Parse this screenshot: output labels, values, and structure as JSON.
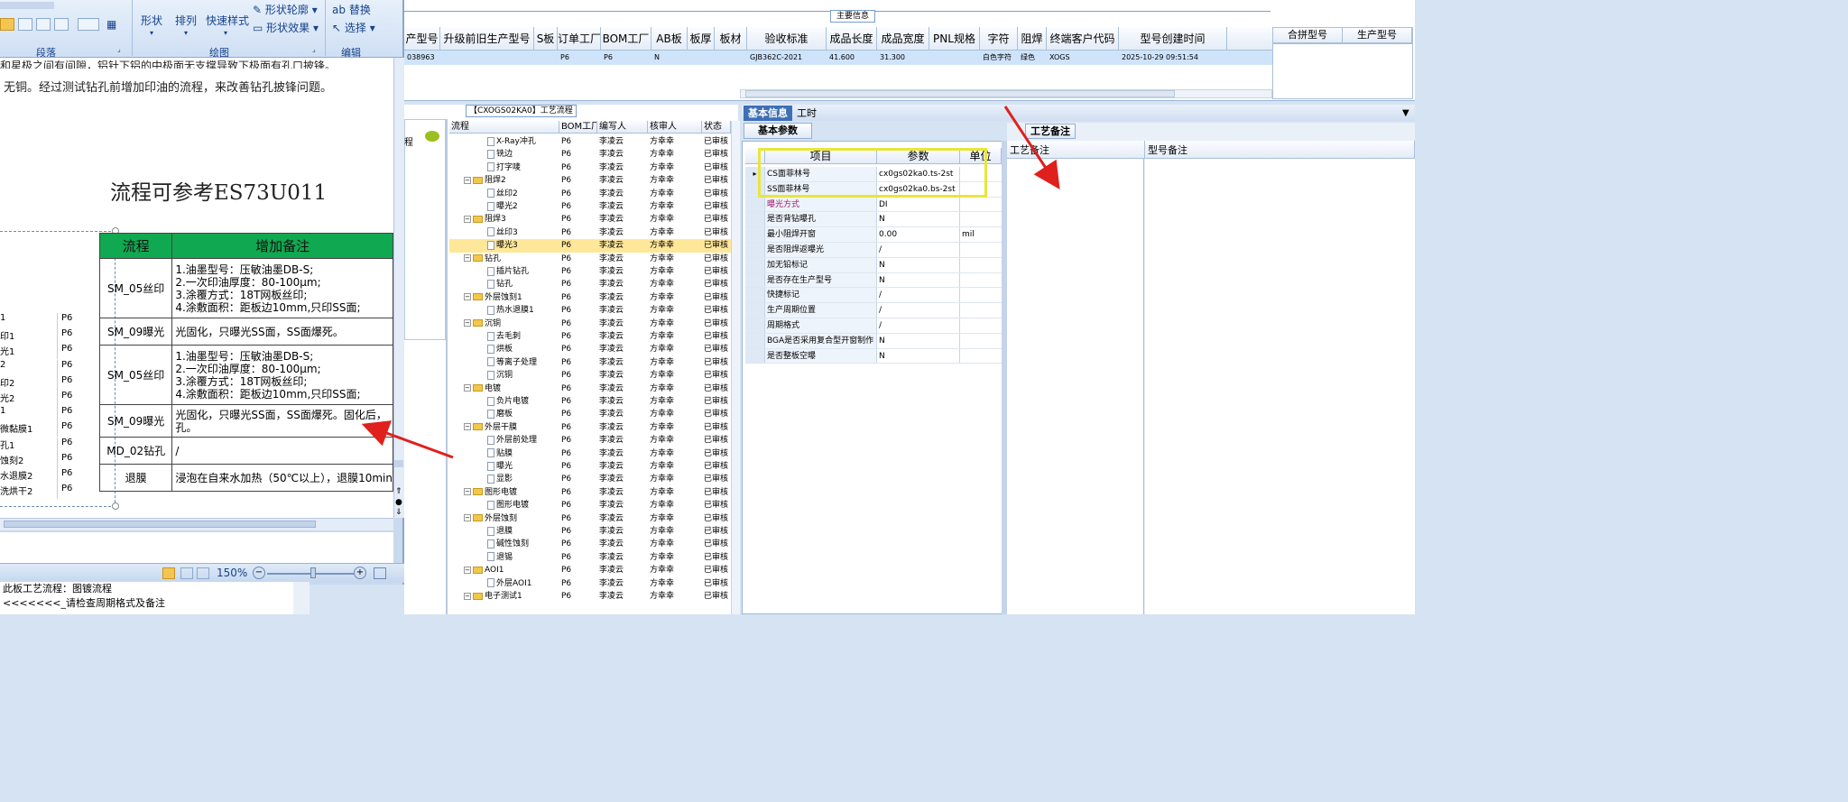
{
  "ribbon": {
    "group_paragraph": "段落",
    "group_drawing": "绘图",
    "group_edit": "编辑",
    "shape_label": "形状",
    "arrange_label": "排列",
    "quick_style_label": "快速样式",
    "shape_outline": "形状轮廓",
    "shape_effect": "形状效果",
    "replace": "替换",
    "select": "选择"
  },
  "document": {
    "line1": "和星极之间有间隙，铝针下铝的中极面无支撑导致下极面有孔口披锋。",
    "line2": "无铜。经过测试钻孔前增加印油的流程，来改善钻孔披锋问题。",
    "title": "流程可参考ES73U011",
    "table_headers": [
      "流程",
      "增加备注"
    ],
    "table_rows": [
      {
        "step": "SM_05丝印",
        "note": [
          "1.油墨型号：压敏油墨DB-S;",
          "2.一次印油厚度：80-100μm;",
          "3.涂覆方式：18T网板丝印;",
          "4.涂敷面积：距板边10mm,只印SS面;"
        ]
      },
      {
        "step": "SM_09曝光",
        "note": [
          "光固化，只曝光SS面，SS面爆死。"
        ]
      },
      {
        "step": "SM_05丝印",
        "note": [
          "1.油墨型号：压敏油墨DB-S;",
          "2.一次印油厚度：80-100μm;",
          "3.涂覆方式：18T网板丝印;",
          "4.涂敷面积：距板边10mm,只印SS面;"
        ]
      },
      {
        "step": "SM_09曝光",
        "note": [
          "光固化，只曝光SS面，SS面爆死。固化后，",
          "孔。"
        ]
      },
      {
        "step": "MD_02钻孔",
        "note": [
          "/"
        ]
      },
      {
        "step": "退膜",
        "note": [
          "浸泡在自来水加热（50℃以上），退膜10min"
        ]
      }
    ],
    "left_list": [
      {
        "name": "1",
        "bom": "P6"
      },
      {
        "name": "印1",
        "bom": "P6"
      },
      {
        "name": "光1",
        "bom": "P6"
      },
      {
        "name": "2",
        "bom": "P6"
      },
      {
        "name": "印2",
        "bom": "P6"
      },
      {
        "name": "光2",
        "bom": "P6"
      },
      {
        "name": "1",
        "bom": "P6"
      },
      {
        "name": "微黏膜1",
        "bom": "P6"
      },
      {
        "name": "孔1",
        "bom": "P6"
      },
      {
        "name": "蚀刻2",
        "bom": "P6"
      },
      {
        "name": "水退膜2",
        "bom": "P6"
      },
      {
        "name": "洗烘干2",
        "bom": "P6"
      }
    ],
    "zoom": "150%",
    "note1": "此板工艺流程：图镀流程",
    "note2": "<<<<<<<_请检查周期格式及备注"
  },
  "top_grid": {
    "section_label": "主要信息",
    "headers": [
      "产型号",
      "升级前旧生产型号",
      "S板",
      "订单工厂",
      "BOM工厂",
      "AB板",
      "板厚",
      "板材",
      "验收标准",
      "成品长度",
      "成品宽度",
      "PNL规格",
      "字符",
      "阻焊",
      "终端客户代码",
      "型号创建时间"
    ],
    "row": [
      "038963",
      "",
      "",
      "P6",
      "P6",
      "N",
      "",
      "",
      "GJB362C-2021",
      "41.600",
      "31.300",
      "",
      "白色字符",
      "绿色",
      "XOGS",
      "2025-10-29 09:51:54"
    ],
    "right_headers": [
      "合拼型号",
      "生产型号"
    ]
  },
  "process": {
    "title": "【CXOGS02KA0】工艺流程",
    "headers": [
      "流程",
      "BOM工厂",
      "编写人",
      "核审人",
      "状态"
    ],
    "rows": [
      {
        "indent": 2,
        "kind": "doc",
        "name": "X-Ray冲孔",
        "bom": "P6",
        "w": "李凌云",
        "r": "方幸幸",
        "s": "已审核"
      },
      {
        "indent": 2,
        "kind": "doc",
        "name": "铣边",
        "bom": "P6",
        "w": "李凌云",
        "r": "方幸幸",
        "s": "已审核"
      },
      {
        "indent": 2,
        "kind": "doc",
        "name": "打字唛",
        "bom": "P6",
        "w": "李凌云",
        "r": "方幸幸",
        "s": "已审核"
      },
      {
        "indent": 1,
        "kind": "folder",
        "name": "阻焊2",
        "bom": "P6",
        "w": "李凌云",
        "r": "方幸幸",
        "s": "已审核"
      },
      {
        "indent": 2,
        "kind": "doc",
        "name": "丝印2",
        "bom": "P6",
        "w": "李凌云",
        "r": "方幸幸",
        "s": "已审核"
      },
      {
        "indent": 2,
        "kind": "doc",
        "name": "曝光2",
        "bom": "P6",
        "w": "李凌云",
        "r": "方幸幸",
        "s": "已审核"
      },
      {
        "indent": 1,
        "kind": "folder",
        "name": "阻焊3",
        "bom": "P6",
        "w": "李凌云",
        "r": "方幸幸",
        "s": "已审核"
      },
      {
        "indent": 2,
        "kind": "doc",
        "name": "丝印3",
        "bom": "P6",
        "w": "李凌云",
        "r": "方幸幸",
        "s": "已审核"
      },
      {
        "indent": 2,
        "kind": "doc",
        "name": "曝光3",
        "bom": "P6",
        "w": "李凌云",
        "r": "方幸幸",
        "s": "已审核",
        "selected": true
      },
      {
        "indent": 1,
        "kind": "folder",
        "name": "钻孔",
        "bom": "P6",
        "w": "李凌云",
        "r": "方幸幸",
        "s": "已审核"
      },
      {
        "indent": 2,
        "kind": "doc",
        "name": "插片钻孔",
        "bom": "P6",
        "w": "李凌云",
        "r": "方幸幸",
        "s": "已审核"
      },
      {
        "indent": 2,
        "kind": "doc",
        "name": "钻孔",
        "bom": "P6",
        "w": "李凌云",
        "r": "方幸幸",
        "s": "已审核"
      },
      {
        "indent": 1,
        "kind": "folder",
        "name": "外层蚀刻1",
        "bom": "P6",
        "w": "李凌云",
        "r": "方幸幸",
        "s": "已审核"
      },
      {
        "indent": 2,
        "kind": "doc",
        "name": "热水退膜1",
        "bom": "P6",
        "w": "李凌云",
        "r": "方幸幸",
        "s": "已审核"
      },
      {
        "indent": 1,
        "kind": "folder",
        "name": "沉铜",
        "bom": "P6",
        "w": "李凌云",
        "r": "方幸幸",
        "s": "已审核"
      },
      {
        "indent": 2,
        "kind": "doc",
        "name": "去毛刺",
        "bom": "P6",
        "w": "李凌云",
        "r": "方幸幸",
        "s": "已审核"
      },
      {
        "indent": 2,
        "kind": "doc",
        "name": "烘板",
        "bom": "P6",
        "w": "李凌云",
        "r": "方幸幸",
        "s": "已审核"
      },
      {
        "indent": 2,
        "kind": "doc",
        "name": "等离子处理",
        "bom": "P6",
        "w": "李凌云",
        "r": "方幸幸",
        "s": "已审核"
      },
      {
        "indent": 2,
        "kind": "doc",
        "name": "沉铜",
        "bom": "P6",
        "w": "李凌云",
        "r": "方幸幸",
        "s": "已审核"
      },
      {
        "indent": 1,
        "kind": "folder",
        "name": "电镀",
        "bom": "P6",
        "w": "李凌云",
        "r": "方幸幸",
        "s": "已审核"
      },
      {
        "indent": 2,
        "kind": "doc",
        "name": "负片电镀",
        "bom": "P6",
        "w": "李凌云",
        "r": "方幸幸",
        "s": "已审核"
      },
      {
        "indent": 2,
        "kind": "doc",
        "name": "磨板",
        "bom": "P6",
        "w": "李凌云",
        "r": "方幸幸",
        "s": "已审核"
      },
      {
        "indent": 1,
        "kind": "folder",
        "name": "外层干膜",
        "bom": "P6",
        "w": "李凌云",
        "r": "方幸幸",
        "s": "已审核"
      },
      {
        "indent": 2,
        "kind": "doc",
        "name": "外层前处理",
        "bom": "P6",
        "w": "李凌云",
        "r": "方幸幸",
        "s": "已审核"
      },
      {
        "indent": 2,
        "kind": "doc",
        "name": "贴膜",
        "bom": "P6",
        "w": "李凌云",
        "r": "方幸幸",
        "s": "已审核"
      },
      {
        "indent": 2,
        "kind": "doc",
        "name": "曝光",
        "bom": "P6",
        "w": "李凌云",
        "r": "方幸幸",
        "s": "已审核"
      },
      {
        "indent": 2,
        "kind": "doc",
        "name": "显影",
        "bom": "P6",
        "w": "李凌云",
        "r": "方幸幸",
        "s": "已审核"
      },
      {
        "indent": 1,
        "kind": "folder",
        "name": "图形电镀",
        "bom": "P6",
        "w": "李凌云",
        "r": "方幸幸",
        "s": "已审核"
      },
      {
        "indent": 2,
        "kind": "doc",
        "name": "图形电镀",
        "bom": "P6",
        "w": "李凌云",
        "r": "方幸幸",
        "s": "已审核"
      },
      {
        "indent": 1,
        "kind": "folder",
        "name": "外层蚀刻",
        "bom": "P6",
        "w": "李凌云",
        "r": "方幸幸",
        "s": "已审核"
      },
      {
        "indent": 2,
        "kind": "doc",
        "name": "退膜",
        "bom": "P6",
        "w": "李凌云",
        "r": "方幸幸",
        "s": "已审核"
      },
      {
        "indent": 2,
        "kind": "doc",
        "name": "碱性蚀刻",
        "bom": "P6",
        "w": "李凌云",
        "r": "方幸幸",
        "s": "已审核"
      },
      {
        "indent": 2,
        "kind": "doc",
        "name": "退锡",
        "bom": "P6",
        "w": "李凌云",
        "r": "方幸幸",
        "s": "已审核"
      },
      {
        "indent": 1,
        "kind": "folder",
        "name": "AOI1",
        "bom": "P6",
        "w": "李凌云",
        "r": "方幸幸",
        "s": "已审核"
      },
      {
        "indent": 2,
        "kind": "doc",
        "name": "外层AOI1",
        "bom": "P6",
        "w": "李凌云",
        "r": "方幸幸",
        "s": "已审核"
      },
      {
        "indent": 1,
        "kind": "folder",
        "name": "电子测试1",
        "bom": "P6",
        "w": "李凌云",
        "r": "方幸幸",
        "s": "已审核"
      }
    ]
  },
  "info": {
    "tab_basic": "基本信息",
    "tab_hours": "工时",
    "subtab_params": "基本参数",
    "headers": [
      "项目",
      "参数",
      "单位"
    ],
    "rows": [
      {
        "name": "CS面菲林号",
        "value": "cx0gs02ka0.ts-2st",
        "unit": "",
        "marker": "▸"
      },
      {
        "name": "SS面菲林号",
        "value": "cx0gs02ka0.bs-2st",
        "unit": ""
      },
      {
        "name": "曝光方式",
        "value": "DI",
        "unit": "",
        "highlight": true
      },
      {
        "name": "是否背钻曝孔",
        "value": "N",
        "unit": ""
      },
      {
        "name": "最小阻焊开窗",
        "value": "0.00",
        "unit": "mil"
      },
      {
        "name": "是否阻焊返曝光",
        "value": "/",
        "unit": ""
      },
      {
        "name": "加无铅标记",
        "value": "N",
        "unit": ""
      },
      {
        "name": "是否存在生产型号",
        "value": "N",
        "unit": ""
      },
      {
        "name": "快捷标记",
        "value": "/",
        "unit": ""
      },
      {
        "name": "生产周期位置",
        "value": "/",
        "unit": ""
      },
      {
        "name": "周期格式",
        "value": "/",
        "unit": ""
      },
      {
        "name": "BGA是否采用复合型开窗制作",
        "value": "N",
        "unit": ""
      },
      {
        "name": "是否整板空曝",
        "value": "N",
        "unit": ""
      }
    ]
  },
  "remarks": {
    "tab": "工艺备注",
    "col1": "工艺备注",
    "col2": "型号备注"
  },
  "colors": {
    "table_header_green": "#10a850",
    "arrow_red": "#e0201c",
    "highlight_yellow": "#e8e63a",
    "tab_blue": "#3d6fb4"
  }
}
